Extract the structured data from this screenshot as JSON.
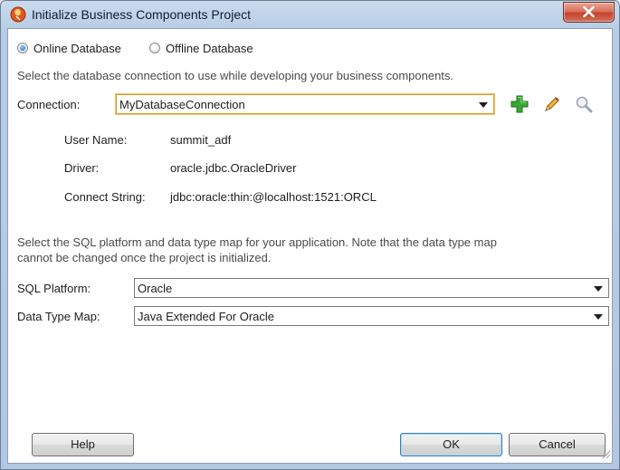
{
  "window": {
    "title": "Initialize Business Components Project",
    "icon": "oracle-jdev-icon",
    "close_icon": "close-icon"
  },
  "database_mode": {
    "online_label": "Online Database",
    "offline_label": "Offline Database",
    "selected": "online"
  },
  "connection_hint": "Select the database connection to use while developing your business components.",
  "connection": {
    "label": "Connection:",
    "value": "MyDatabaseConnection",
    "add_icon": "plus-icon",
    "edit_icon": "pencil-icon",
    "browse_icon": "magnifier-icon"
  },
  "details": {
    "user_name_label": "User Name:",
    "user_name": "summit_adf",
    "driver_label": "Driver:",
    "driver": "oracle.jdbc.OracleDriver",
    "connect_string_label": "Connect String:",
    "connect_string": "jdbc:oracle:thin:@localhost:1521:ORCL"
  },
  "platform_hint_line1": "Select the SQL platform and data type map for your application.  Note that the data type map",
  "platform_hint_line2": "cannot be changed once the project is initialized.",
  "sql_platform": {
    "label": "SQL Platform:",
    "value": "Oracle"
  },
  "data_type_map": {
    "label": "Data Type Map:",
    "value": "Java Extended For Oracle"
  },
  "buttons": {
    "help": "Help",
    "ok": "OK",
    "cancel": "Cancel"
  },
  "colors": {
    "accent": "#3c7fb1",
    "focus": "#d89c2d",
    "add": "#3aa635",
    "close": "#c2432b"
  }
}
